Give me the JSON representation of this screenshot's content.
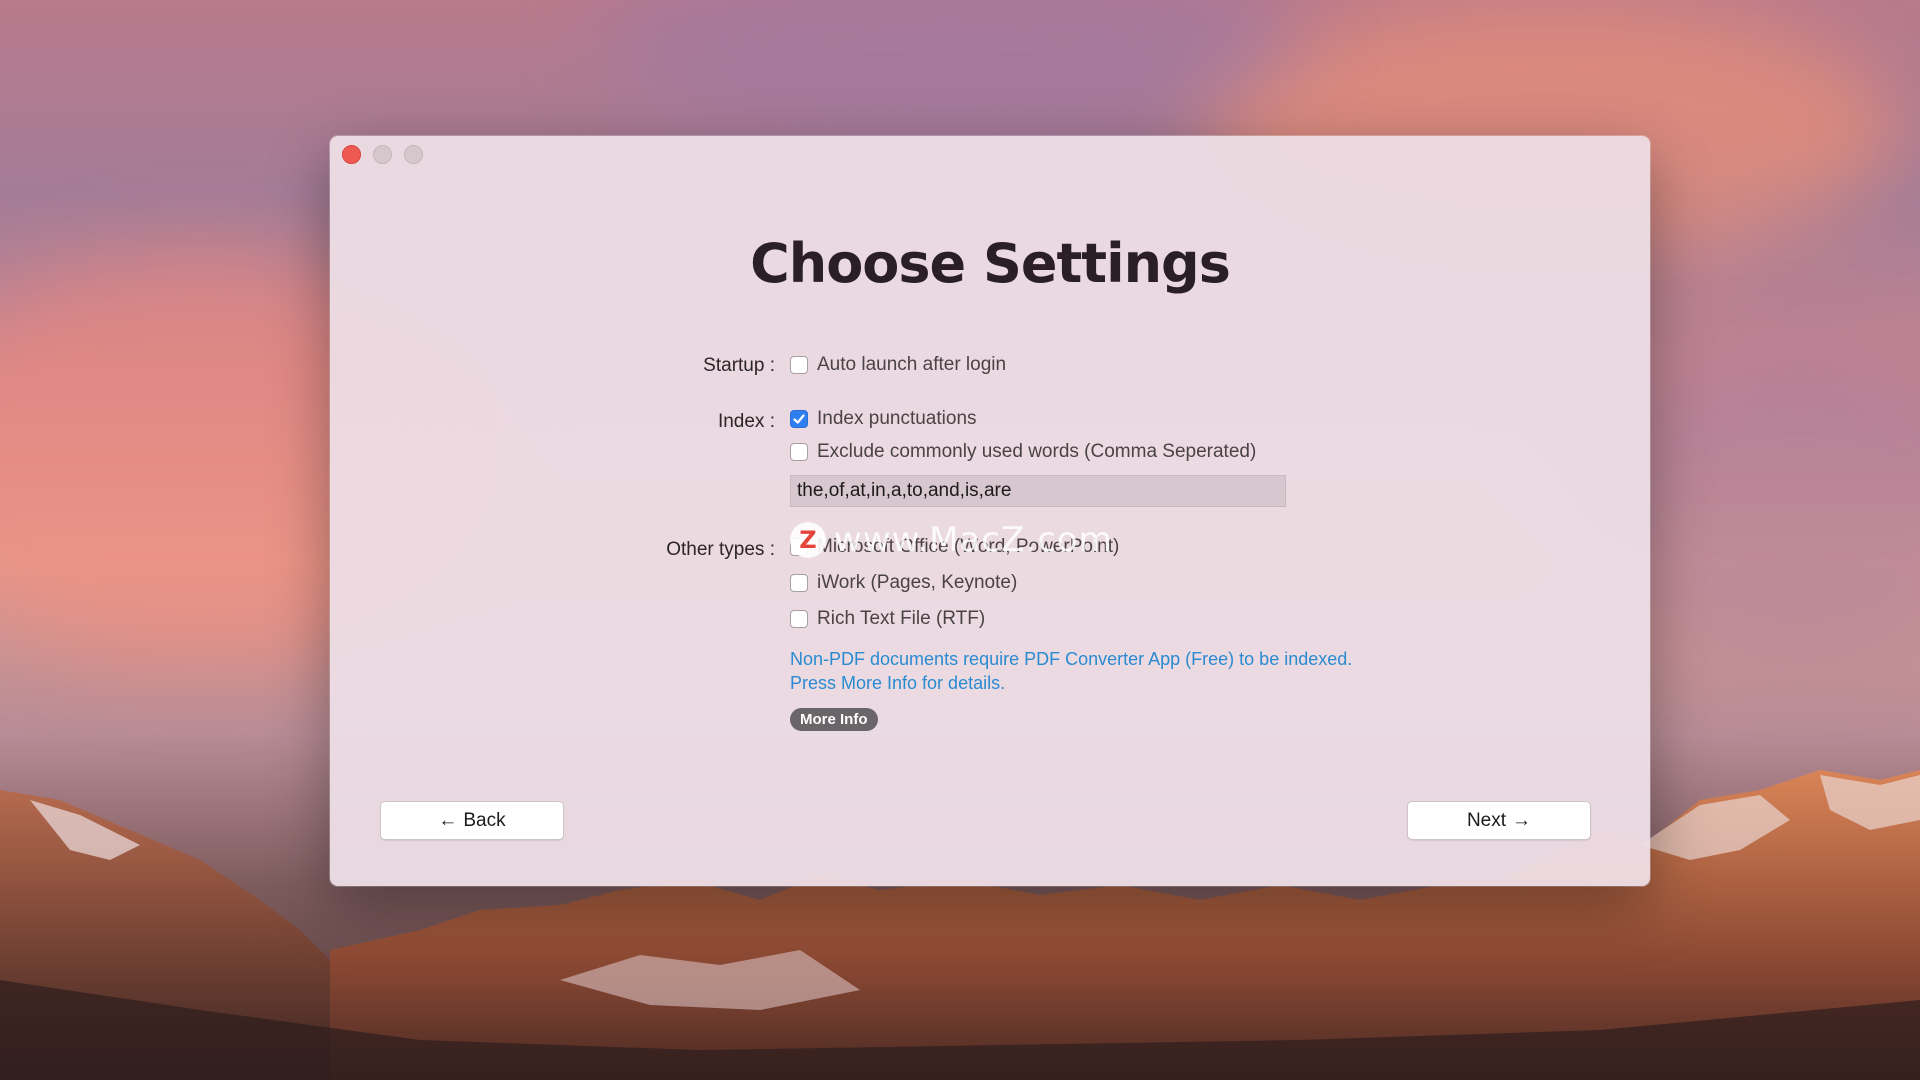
{
  "window": {
    "title": "Choose Settings"
  },
  "startup": {
    "label": "Startup :",
    "options": [
      {
        "label": "Auto launch after login",
        "checked": false
      }
    ]
  },
  "index": {
    "label": "Index :",
    "options": [
      {
        "label": "Index punctuations",
        "checked": true
      },
      {
        "label": "Exclude commonly used words (Comma Seperated)",
        "checked": false
      }
    ],
    "excluded_words_value": "the,of,at,in,a,to,and,is,are"
  },
  "other_types": {
    "label": "Other types :",
    "options": [
      {
        "label": "Microsoft Office (Word, PowerPoint)",
        "checked": false
      },
      {
        "label": "iWork (Pages, Keynote)",
        "checked": false
      },
      {
        "label": "Rich Text File (RTF)",
        "checked": false
      }
    ]
  },
  "info": {
    "line1": "Non-PDF documents require PDF Converter App (Free) to be indexed.",
    "line2": "Press More Info for details."
  },
  "more_info_label": "More Info",
  "back_label": "Back",
  "next_label": "Next",
  "watermark": {
    "logo_letter": "Z",
    "text": "www.MacZ.com"
  },
  "colors": {
    "accent": "#2f7ff0",
    "info_text": "#2a8bd1",
    "close_button": "#ee5a52"
  }
}
